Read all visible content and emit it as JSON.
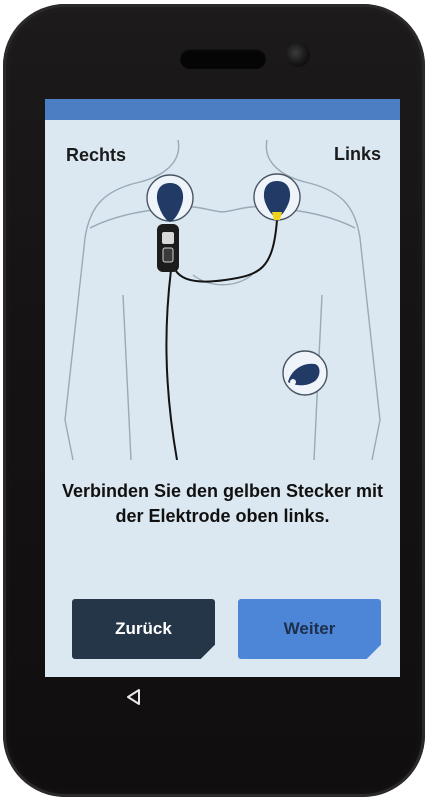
{
  "screen": {
    "label_right": "Rechts",
    "label_left": "Links",
    "instruction": "Verbinden Sie den gelben Stecker mit der Elektrode oben links.",
    "buttons": {
      "back": "Zurück",
      "next": "Weiter"
    }
  },
  "colors": {
    "header_strip": "#4a7fc3",
    "screen_bg": "#dbe8f2",
    "back_button": "#263649",
    "next_button": "#4d86d6",
    "electrode": "#213a66",
    "yellow_connector": "#f0d21a"
  },
  "icons": {
    "nav": "back-triangle-icon"
  }
}
